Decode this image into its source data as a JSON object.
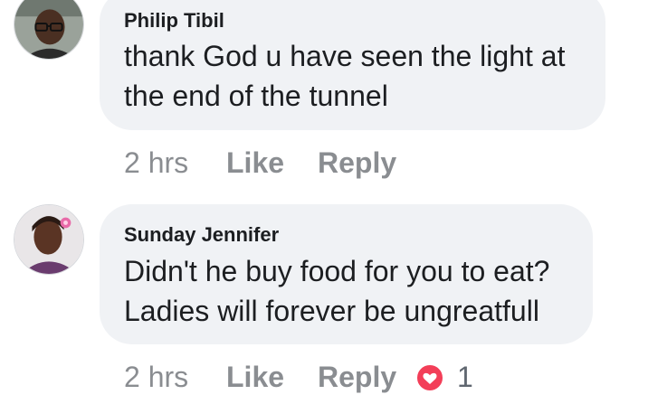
{
  "comments": [
    {
      "author": "Philip Tibil",
      "text_lines": [
        "thank God u have seen the light at",
        "the end of the tunnel"
      ],
      "time": "2 hrs",
      "like_label": "Like",
      "reply_label": "Reply",
      "avatar": "man-with-glasses-avatar"
    },
    {
      "author": "Sunday Jennifer",
      "text_lines": [
        "Didn't he buy food for you to eat?",
        "Ladies will forever be ungreatfull"
      ],
      "time": "2 hrs",
      "like_label": "Like",
      "reply_label": "Reply",
      "avatar": "woman-with-flower-avatar",
      "reaction": {
        "icon": "heart-icon",
        "color": "#f33e58",
        "count": "1"
      }
    }
  ],
  "colors": {
    "bubble": "#f0f2f5",
    "meta_text": "#8a8d91",
    "heart": "#f33e58"
  }
}
